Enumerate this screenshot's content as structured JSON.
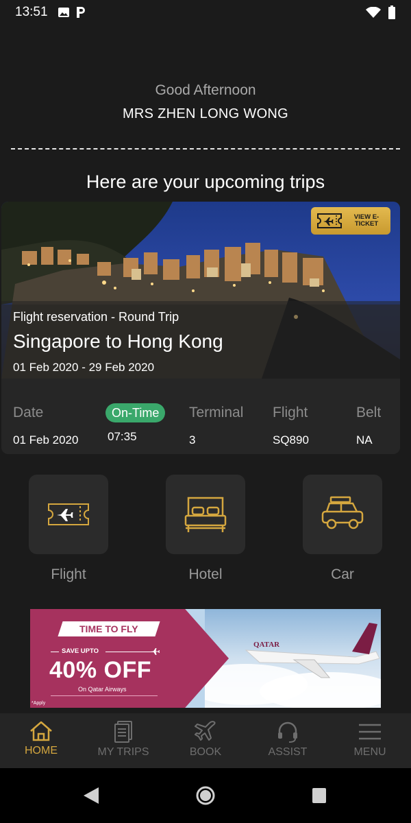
{
  "status_bar": {
    "time": "13:51"
  },
  "greeting": {
    "salutation": "Good Afternoon",
    "name": "MRS ZHEN LONG WONG"
  },
  "section_title": "Here are your upcoming trips",
  "trip": {
    "type": "Flight reservation - Round Trip",
    "route": "Singapore to Hong Kong",
    "dates": "01 Feb 2020 - 29 Feb 2020",
    "eticket_label": "VIEW E-TICKET",
    "status": "On-Time",
    "date_label": "Date",
    "date_value": "01 Feb 2020",
    "time_value": "07:35",
    "terminal_label": "Terminal",
    "terminal_value": "3",
    "flight_label": "Flight",
    "flight_value": "SQ890",
    "belt_label": "Belt",
    "belt_value": "NA"
  },
  "services": [
    {
      "label": "Flight",
      "icon": "ticket-plane-icon"
    },
    {
      "label": "Hotel",
      "icon": "bed-icon"
    },
    {
      "label": "Car",
      "icon": "car-icon"
    }
  ],
  "promo": {
    "tag": "TIME TO FLY",
    "save": "SAVE UPTO",
    "offer": "40% OFF",
    "airline_line": "On Qatar Airways",
    "apply": "*Apply",
    "airline_livery": "QATAR"
  },
  "bottom_nav": [
    {
      "label": "HOME",
      "icon": "home-icon",
      "active": true
    },
    {
      "label": "MY TRIPS",
      "icon": "documents-icon",
      "active": false
    },
    {
      "label": "BOOK",
      "icon": "plane-icon",
      "active": false
    },
    {
      "label": "ASSIST",
      "icon": "headset-icon",
      "active": false
    },
    {
      "label": "MENU",
      "icon": "menu-icon",
      "active": false
    }
  ],
  "colors": {
    "accent_gold": "#d5a73f",
    "status_green": "#3aa86b",
    "background": "#1b1b1b"
  }
}
